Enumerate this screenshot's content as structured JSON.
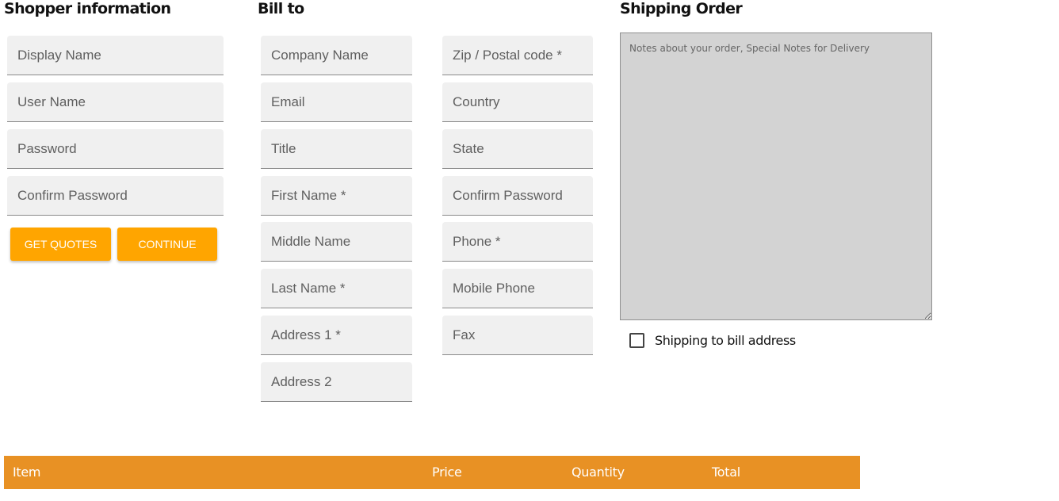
{
  "shopper": {
    "heading": "Shopper information",
    "fields": [
      {
        "placeholder": "Display Name"
      },
      {
        "placeholder": "User Name"
      },
      {
        "placeholder": "Password"
      },
      {
        "placeholder": "Confirm Password"
      }
    ],
    "get_quotes_label": "GET QUOTES",
    "continue_label": "CONTINUE"
  },
  "bill_to": {
    "heading": "Bill to",
    "left_fields": [
      {
        "placeholder": "Company Name"
      },
      {
        "placeholder": "Email"
      },
      {
        "placeholder": "Title"
      },
      {
        "placeholder": "First Name *"
      },
      {
        "placeholder": "Middle Name"
      },
      {
        "placeholder": "Last Name *"
      },
      {
        "placeholder": "Address 1 *"
      },
      {
        "placeholder": "Address 2"
      }
    ],
    "right_fields": [
      {
        "placeholder": "Zip / Postal code *"
      },
      {
        "placeholder": "Country"
      },
      {
        "placeholder": "State"
      },
      {
        "placeholder": "Confirm Password"
      },
      {
        "placeholder": "Phone *"
      },
      {
        "placeholder": "Mobile Phone"
      },
      {
        "placeholder": "Fax"
      }
    ]
  },
  "shipping": {
    "heading": "Shipping Order",
    "notes_placeholder": "Notes about your order, Special Notes for Delivery",
    "checkbox_label": "Shipping to bill address",
    "checkbox_checked": false
  },
  "table": {
    "columns": [
      "Item",
      "Price",
      "Quantity",
      "Total"
    ]
  },
  "colors": {
    "button": "#ffa500",
    "table_header": "#e89124",
    "field_bg": "#f0f0f0",
    "notes_bg": "#d3d3d3"
  }
}
